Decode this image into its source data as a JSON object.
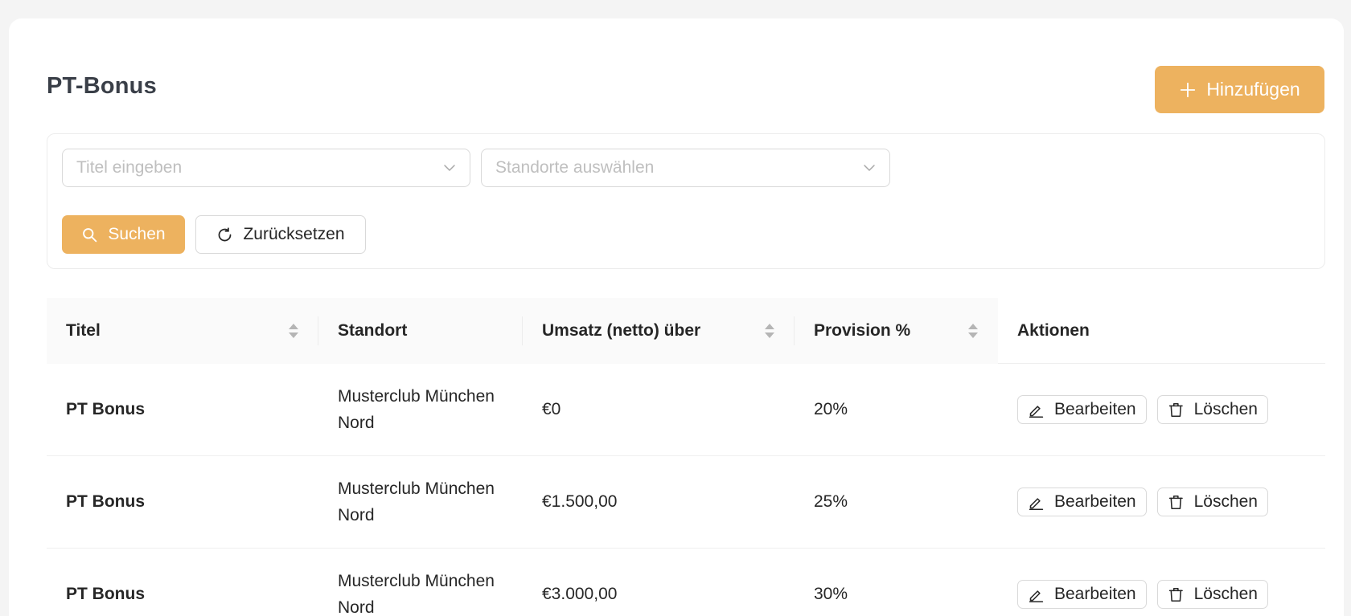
{
  "page": {
    "title": "PT-Bonus",
    "add_label": "Hinzufügen"
  },
  "filters": {
    "title_placeholder": "Titel eingeben",
    "location_placeholder": "Standorte auswählen",
    "search_label": "Suchen",
    "reset_label": "Zurücksetzen"
  },
  "table": {
    "columns": [
      "Titel",
      "Standort",
      "Umsatz (netto) über",
      "Provision %",
      "Aktionen"
    ],
    "rows": [
      {
        "title": "PT Bonus",
        "location": "Musterclub München Nord",
        "revenue": "€0",
        "commission": "20%"
      },
      {
        "title": "PT Bonus",
        "location": "Musterclub München Nord",
        "revenue": "€1.500,00",
        "commission": "25%"
      },
      {
        "title": "PT Bonus",
        "location": "Musterclub München Nord",
        "revenue": "€3.000,00",
        "commission": "30%"
      }
    ],
    "edit_label": "Bearbeiten",
    "delete_label": "Löschen"
  },
  "colors": {
    "accent": "#edb25f",
    "header_bg": "#fafafa",
    "border": "#d9d9d9"
  },
  "icons": [
    "plus-icon",
    "chevron-down-icon",
    "search-icon",
    "reload-icon",
    "sort-icon",
    "edit-icon",
    "trash-icon"
  ]
}
